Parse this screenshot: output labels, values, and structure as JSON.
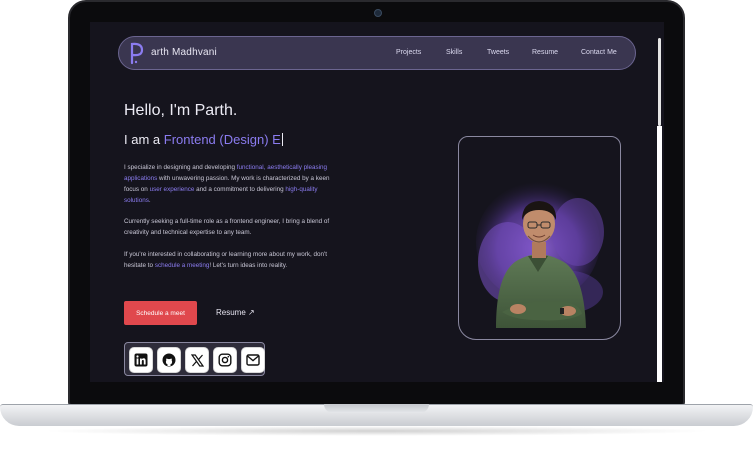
{
  "nav": {
    "brand": "arth Madhvani",
    "links": [
      "Projects",
      "Skills",
      "Tweets",
      "Resume",
      "Contact Me"
    ]
  },
  "hero": {
    "greeting": "Hello, I'm Parth.",
    "role_prefix": "I am a ",
    "role_typed": "Frontend (Design) E",
    "para1": [
      {
        "t": "I specialize in designing and developing ",
        "hl": false
      },
      {
        "t": "functional, aesthetically pleasing applications",
        "hl": true
      },
      {
        "t": " with unwavering passion. My work is characterized by a keen focus on ",
        "hl": false
      },
      {
        "t": "user experience",
        "hl": true
      },
      {
        "t": " and a commitment to delivering ",
        "hl": false
      },
      {
        "t": "high-quality solutions",
        "hl": true
      },
      {
        "t": ".",
        "hl": false
      }
    ],
    "para2": "Currently seeking a full-time role as a frontend engineer, I bring a blend of creativity and technical expertise to any team.",
    "para3": [
      {
        "t": "If you're interested in collaborating or learning more about my work, don't hesitate to ",
        "hl": false
      },
      {
        "t": "schedule a meeting",
        "hl": true
      },
      {
        "t": "! Let's turn ideas into reality.",
        "hl": false
      }
    ],
    "cta_label": "Schedule a meet",
    "resume_label": "Resume ↗"
  },
  "socials": [
    "linkedin-icon",
    "github-icon",
    "x-icon",
    "instagram-icon",
    "mail-icon"
  ],
  "colors": {
    "background": "#15141d",
    "accent": "#8b7cf0",
    "cta": "#e0484d",
    "nav": "#3a3650"
  }
}
